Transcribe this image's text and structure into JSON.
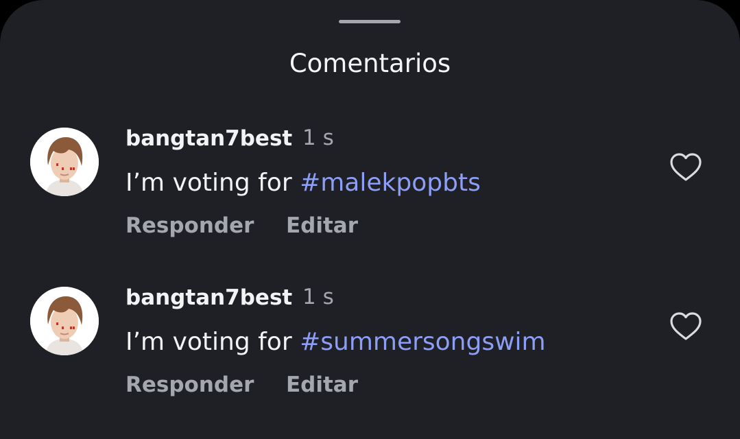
{
  "sheet": {
    "title": "Comentarios"
  },
  "comments": [
    {
      "username": "bangtan7best",
      "time": "1 s",
      "text_prefix": "I’m voting for ",
      "hashtag": "#malekpopbts",
      "reply_label": "Responder",
      "edit_label": "Editar",
      "like_icon": "heart-outline-icon"
    },
    {
      "username": "bangtan7best",
      "time": "1 s",
      "text_prefix": "I’m voting for ",
      "hashtag": "#summersongswim",
      "reply_label": "Responder",
      "edit_label": "Editar",
      "like_icon": "heart-outline-icon"
    }
  ],
  "colors": {
    "background": "#1e2025",
    "text": "#f2f3f5",
    "secondary_text": "#a4a7ae",
    "hashtag": "#8c9ef5"
  }
}
